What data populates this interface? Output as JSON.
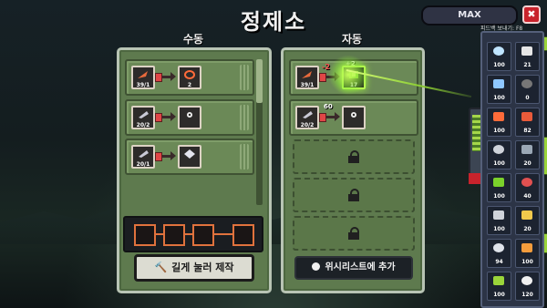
{
  "title": "정제소",
  "top": {
    "max_label": "MAX",
    "close_glyph": "✖"
  },
  "manual": {
    "header": "수동",
    "recipes": [
      {
        "in_count": "39/1",
        "out_count": "2"
      },
      {
        "in_count": "20/2",
        "out_count": ""
      },
      {
        "in_count": "20/1",
        "out_count": ""
      }
    ],
    "craft_button": "길게 눌러 제작"
  },
  "auto": {
    "header": "자동",
    "recipes": [
      {
        "in_count": "39/1",
        "out_count": "17",
        "consume_badge": "-2",
        "badge2": "+2"
      },
      {
        "in_count": "20/2",
        "out_count": "",
        "consume_badge": "60"
      }
    ],
    "wishlist_button": "위시리스트에 추가"
  },
  "inventory": {
    "header": "피드백 보내기: F8",
    "items": [
      {
        "icon": "feather-icon",
        "count": "100"
      },
      {
        "icon": "bone-icon",
        "count": "21"
      },
      {
        "icon": "crystal-blue-icon",
        "count": "100"
      },
      {
        "icon": "bomb-icon",
        "count": "0"
      },
      {
        "icon": "rope-icon",
        "count": "100"
      },
      {
        "icon": "meat-icon",
        "count": "82"
      },
      {
        "icon": "shell-icon",
        "count": "100"
      },
      {
        "icon": "fish-icon",
        "count": "20"
      },
      {
        "icon": "slime-icon",
        "count": "100"
      },
      {
        "icon": "mushroom-icon",
        "count": "40"
      },
      {
        "icon": "robot-icon",
        "count": "100"
      },
      {
        "icon": "gold-ore-icon",
        "count": "20"
      },
      {
        "icon": "diamond-icon",
        "count": "94"
      },
      {
        "icon": "wing-icon",
        "count": "100"
      },
      {
        "icon": "orb-icon",
        "count": "100"
      },
      {
        "icon": "gear-icon",
        "count": "120"
      }
    ]
  }
}
